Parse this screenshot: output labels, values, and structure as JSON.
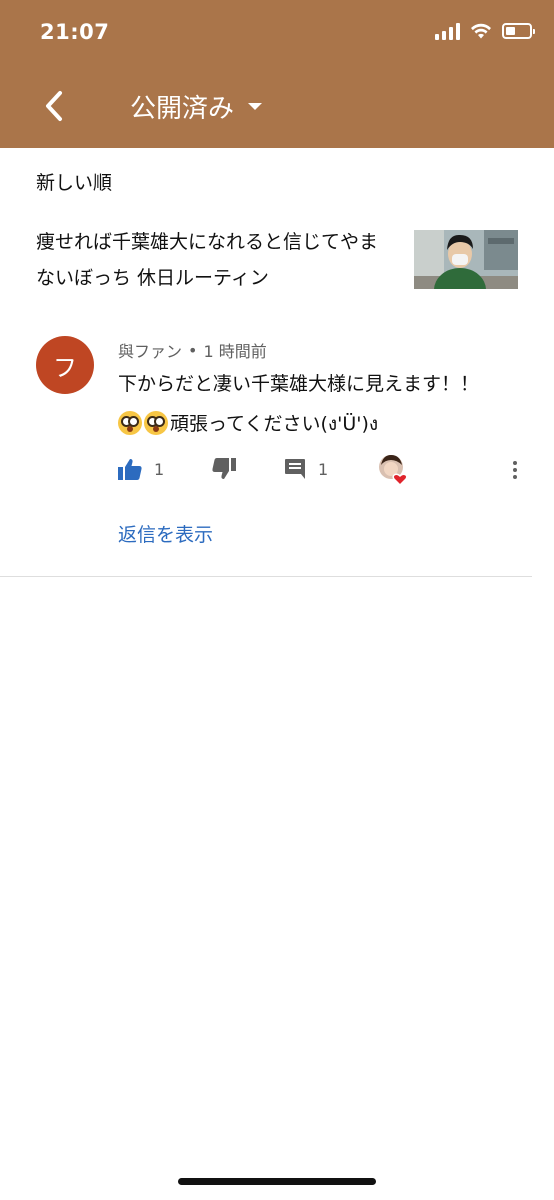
{
  "status_bar": {
    "time": "21:07",
    "signal_icon": "signal-icon",
    "wifi_icon": "wifi-icon",
    "battery_icon": "battery-icon",
    "battery_level": 0.35
  },
  "header": {
    "title": "公開済み",
    "back_icon": "back-arrow-icon",
    "dropdown_icon": "caret-down-icon",
    "background_color": "#aa754a"
  },
  "sort": {
    "label": "新しい順"
  },
  "video": {
    "title": "痩せれば千葉雄大になれると信じてやまないぼっち 休日ルーティン"
  },
  "comment": {
    "avatar_letter": "フ",
    "avatar_color": "#bf4623",
    "author": "與ファン",
    "separator": "•",
    "time": "1 時間前",
    "text_line1": "下からだと凄い千葉雄大様に見えます！！",
    "text_line2_after_emoji": "頑張ってください(ง'Ü')ง",
    "emoji_icon": "flushed-face-emoji-icon",
    "likes": "1",
    "replies_count": "1",
    "like_icon": "thumb-up-icon",
    "dislike_icon": "thumb-down-icon",
    "reply_icon": "comment-icon",
    "hearted_icon": "creator-heart-icon",
    "more_icon": "more-vertical-icon",
    "show_replies_label": "返信を表示",
    "accent_color": "#2c6bbf"
  }
}
